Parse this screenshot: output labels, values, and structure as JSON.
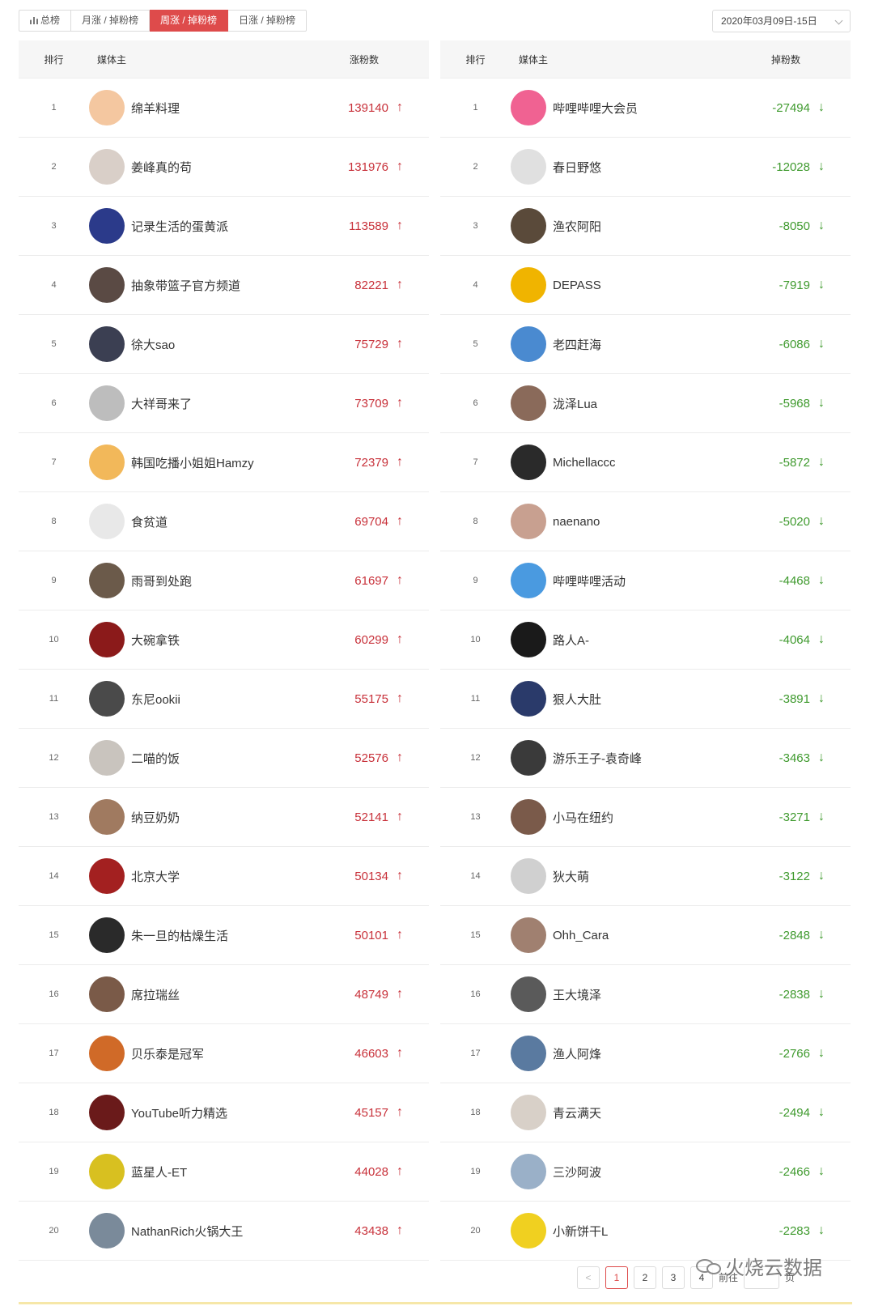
{
  "tabs": [
    "总榜",
    "月涨 / 掉粉榜",
    "周涨 / 掉粉榜",
    "日涨 / 掉粉榜"
  ],
  "active_tab": 2,
  "date_range": "2020年03月09日-15日",
  "left_table": {
    "headers": {
      "rank": "排行",
      "name": "媒体主",
      "value": "涨粉数"
    },
    "rows": [
      {
        "rank": "1",
        "name": "绵羊料理",
        "value": "139140",
        "avatar_color": "#f4c7a0"
      },
      {
        "rank": "2",
        "name": "姜峰真的苟",
        "value": "131976",
        "avatar_color": "#d9cfc8"
      },
      {
        "rank": "3",
        "name": "记录生活的蛋黄派",
        "value": "113589",
        "avatar_color": "#2b3a8a"
      },
      {
        "rank": "4",
        "name": "抽象带篮子官方频道",
        "value": "82221",
        "avatar_color": "#5a4a44"
      },
      {
        "rank": "5",
        "name": "徐大sao",
        "value": "75729",
        "avatar_color": "#3b3f52"
      },
      {
        "rank": "6",
        "name": "大祥哥来了",
        "value": "73709",
        "avatar_color": "#bdbdbd"
      },
      {
        "rank": "7",
        "name": "韩国吃播小姐姐Hamzy",
        "value": "72379",
        "avatar_color": "#f2b85a"
      },
      {
        "rank": "8",
        "name": "食贫道",
        "value": "69704",
        "avatar_color": "#e8e8e8"
      },
      {
        "rank": "9",
        "name": "雨哥到处跑",
        "value": "61697",
        "avatar_color": "#6b5a4a"
      },
      {
        "rank": "10",
        "name": "大碗拿铁",
        "value": "60299",
        "avatar_color": "#8b1a1a"
      },
      {
        "rank": "11",
        "name": "东尼ookii",
        "value": "55175",
        "avatar_color": "#4a4a4a"
      },
      {
        "rank": "12",
        "name": "二喵的饭",
        "value": "52576",
        "avatar_color": "#c9c4be"
      },
      {
        "rank": "13",
        "name": "纳豆奶奶",
        "value": "52141",
        "avatar_color": "#a07a60"
      },
      {
        "rank": "14",
        "name": "北京大学",
        "value": "50134",
        "avatar_color": "#a32020"
      },
      {
        "rank": "15",
        "name": "朱一旦的枯燥生活",
        "value": "50101",
        "avatar_color": "#2a2a2a"
      },
      {
        "rank": "16",
        "name": "席拉瑞丝",
        "value": "48749",
        "avatar_color": "#7a5a48"
      },
      {
        "rank": "17",
        "name": "贝乐泰是冠军",
        "value": "46603",
        "avatar_color": "#d06a28"
      },
      {
        "rank": "18",
        "name": "YouTube听力精选",
        "value": "45157",
        "avatar_color": "#6a1a1a"
      },
      {
        "rank": "19",
        "name": "蓝星人-ET",
        "value": "44028",
        "avatar_color": "#d8c020"
      },
      {
        "rank": "20",
        "name": "NathanRich火锅大王",
        "value": "43438",
        "avatar_color": "#7a8a9a"
      }
    ]
  },
  "right_table": {
    "headers": {
      "rank": "排行",
      "name": "媒体主",
      "value": "掉粉数"
    },
    "rows": [
      {
        "rank": "1",
        "name": "哔哩哔哩大会员",
        "value": "-27494",
        "avatar_color": "#f06292"
      },
      {
        "rank": "2",
        "name": "春日野悠",
        "value": "-12028",
        "avatar_color": "#e0e0e0"
      },
      {
        "rank": "3",
        "name": "渔农阿阳",
        "value": "-8050",
        "avatar_color": "#5a4a3a"
      },
      {
        "rank": "4",
        "name": "DEPASS",
        "value": "-7919",
        "avatar_color": "#f0b400"
      },
      {
        "rank": "5",
        "name": "老四赶海",
        "value": "-6086",
        "avatar_color": "#4a8ad0"
      },
      {
        "rank": "6",
        "name": "泷泽Lua",
        "value": "-5968",
        "avatar_color": "#8a6a5a"
      },
      {
        "rank": "7",
        "name": "Michellaccc",
        "value": "-5872",
        "avatar_color": "#2a2a2a"
      },
      {
        "rank": "8",
        "name": "naenano",
        "value": "-5020",
        "avatar_color": "#c8a090"
      },
      {
        "rank": "9",
        "name": "哔哩哔哩活动",
        "value": "-4468",
        "avatar_color": "#4a9ae0"
      },
      {
        "rank": "10",
        "name": "路人A-",
        "value": "-4064",
        "avatar_color": "#1a1a1a"
      },
      {
        "rank": "11",
        "name": "狠人大肚",
        "value": "-3891",
        "avatar_color": "#2a3a6a"
      },
      {
        "rank": "12",
        "name": "游乐王子-袁奇峰",
        "value": "-3463",
        "avatar_color": "#3a3a3a"
      },
      {
        "rank": "13",
        "name": "小马在纽约",
        "value": "-3271",
        "avatar_color": "#7a5a4a"
      },
      {
        "rank": "14",
        "name": "狄大萌",
        "value": "-3122",
        "avatar_color": "#d0d0d0"
      },
      {
        "rank": "15",
        "name": "Ohh_Cara",
        "value": "-2848",
        "avatar_color": "#a08070"
      },
      {
        "rank": "16",
        "name": "王大境泽",
        "value": "-2838",
        "avatar_color": "#5a5a5a"
      },
      {
        "rank": "17",
        "name": "渔人阿烽",
        "value": "-2766",
        "avatar_color": "#5a7aa0"
      },
      {
        "rank": "18",
        "name": "青云满天",
        "value": "-2494",
        "avatar_color": "#d8d0c8"
      },
      {
        "rank": "19",
        "name": "三沙阿波",
        "value": "-2466",
        "avatar_color": "#9ab0c8"
      },
      {
        "rank": "20",
        "name": "小新饼干L",
        "value": "-2283",
        "avatar_color": "#f0d020"
      }
    ]
  },
  "pagination": {
    "prev": "<",
    "pages": [
      "1",
      "2",
      "3",
      "4"
    ],
    "active_page": "1",
    "goto_label": "前往",
    "page_suffix": "页"
  },
  "watermark": "火烧云数据",
  "arrows": {
    "up": "↑",
    "down": "↓"
  }
}
